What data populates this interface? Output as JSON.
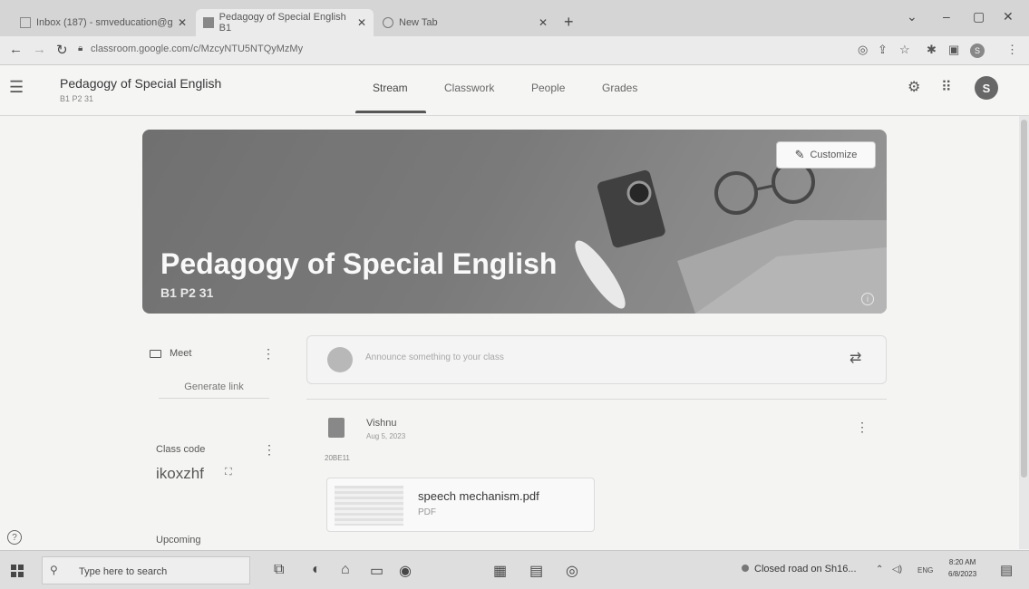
{
  "browser": {
    "tabs": [
      {
        "title": "Inbox (187) - smveducation@g"
      },
      {
        "title": "Pedagogy of Special English B1"
      },
      {
        "title": "New Tab"
      }
    ],
    "url": "classroom.google.com/c/MzcyNTU5NTQyMzMy",
    "new_tab_symbol": "+"
  },
  "classroom": {
    "class_name": "Pedagogy of Special English",
    "section": "B1 P2 31",
    "tabs": [
      "Stream",
      "Classwork",
      "People",
      "Grades"
    ],
    "active_tab": "Stream",
    "avatar_letter": "S"
  },
  "banner": {
    "title": "Pedagogy of Special English",
    "subtitle": "B1 P2 31",
    "customize_label": "Customize"
  },
  "sidebar": {
    "meet_label": "Meet",
    "generate_link_label": "Generate link",
    "class_code_label": "Class code",
    "class_code_value": "ikoxzhf",
    "upcoming_label": "Upcoming"
  },
  "stream": {
    "announce_placeholder": "Announce something to your class",
    "post": {
      "author": "Vishnu",
      "date": "Aug 5, 2023",
      "tag": "20BE11",
      "attachment_name": "speech mechanism.pdf",
      "attachment_type": "PDF"
    }
  },
  "taskbar": {
    "search_placeholder": "Type here to search",
    "weather_text": "Closed road on Sh16...",
    "language": "ENG",
    "time": "8:20 AM",
    "date": "6/8/2023"
  },
  "colors": {
    "banner": "#777777",
    "active_tab_underline": "#555555"
  }
}
